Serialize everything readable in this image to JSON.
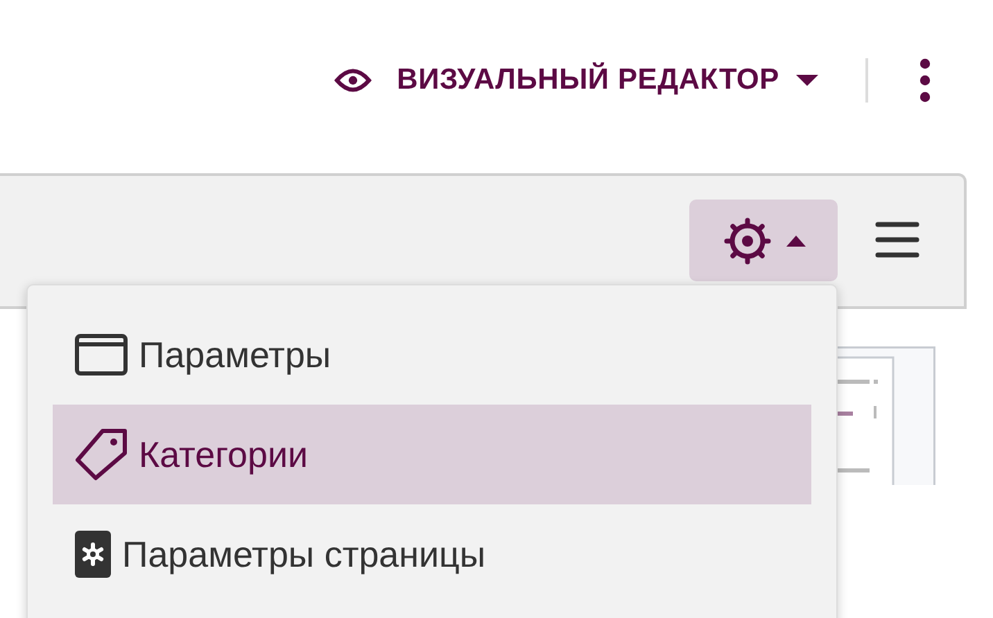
{
  "header": {
    "editor_mode": {
      "label": "ВИЗУАЛЬНЫЙ РЕДАКТОР"
    }
  },
  "toolbar": {
    "settings_button": {
      "expanded": true
    }
  },
  "menu": {
    "items": [
      {
        "label": "Параметры",
        "kind": "window",
        "selected": false
      },
      {
        "label": "Категории",
        "kind": "tag",
        "selected": true
      },
      {
        "label": "Параметры страницы",
        "kind": "page-settings",
        "selected": false
      }
    ]
  }
}
